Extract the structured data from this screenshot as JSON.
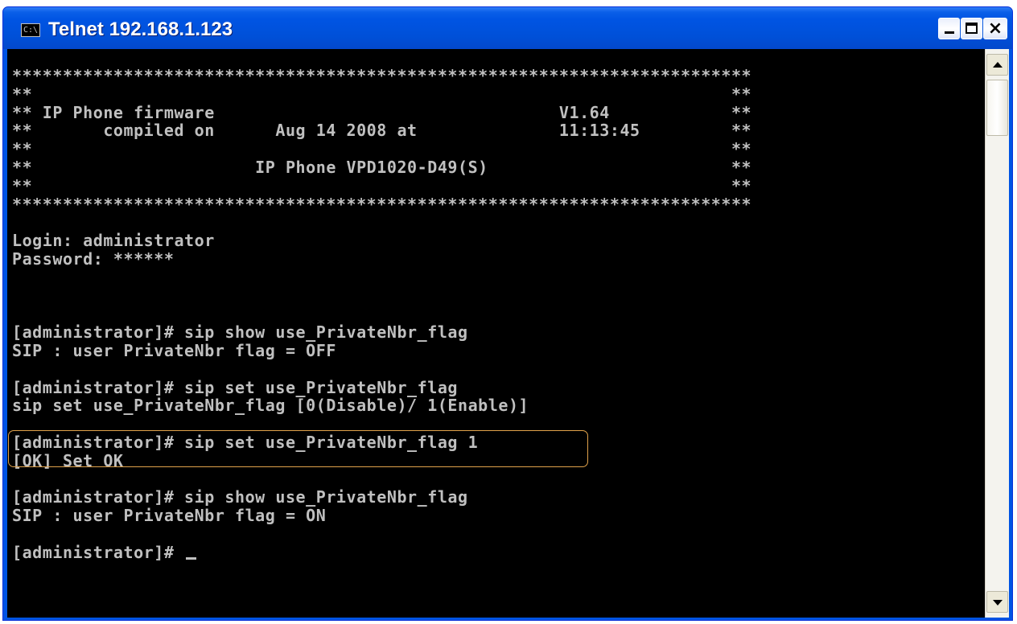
{
  "window": {
    "title": "Telnet 192.168.1.123",
    "icon_text": "C:\\",
    "minimize_glyph": "",
    "maximize_glyph": "",
    "close_glyph": "×"
  },
  "terminal": {
    "lines": [
      "*************************************************************************",
      "**                                                                     **",
      "** IP Phone firmware                                  V1.64            **",
      "**       compiled on      Aug 14 2008 at              11:13:45         **",
      "**                                                                     **",
      "**                      IP Phone VPD1020-D49(S)                        **",
      "**                                                                     **",
      "*************************************************************************",
      "",
      "Login: administrator",
      "Password: ******",
      "",
      "",
      "",
      "[administrator]# sip show use_PrivateNbr_flag",
      "SIP : user PrivateNbr flag = OFF",
      "",
      "[administrator]# sip set use_PrivateNbr_flag",
      "sip set use_PrivateNbr_flag [0(Disable)/ 1(Enable)]",
      "",
      "[administrator]# sip set use_PrivateNbr_flag 1",
      "[OK] Set OK",
      "",
      "[administrator]# sip show use_PrivateNbr_flag",
      "SIP : user PrivateNbr flag = ON",
      "",
      "[administrator]# "
    ]
  },
  "colors": {
    "titlebar": "#0054e3",
    "terminal_bg": "#000000",
    "terminal_fg": "#c0c0c0",
    "highlight_border": "#e0a24b"
  }
}
